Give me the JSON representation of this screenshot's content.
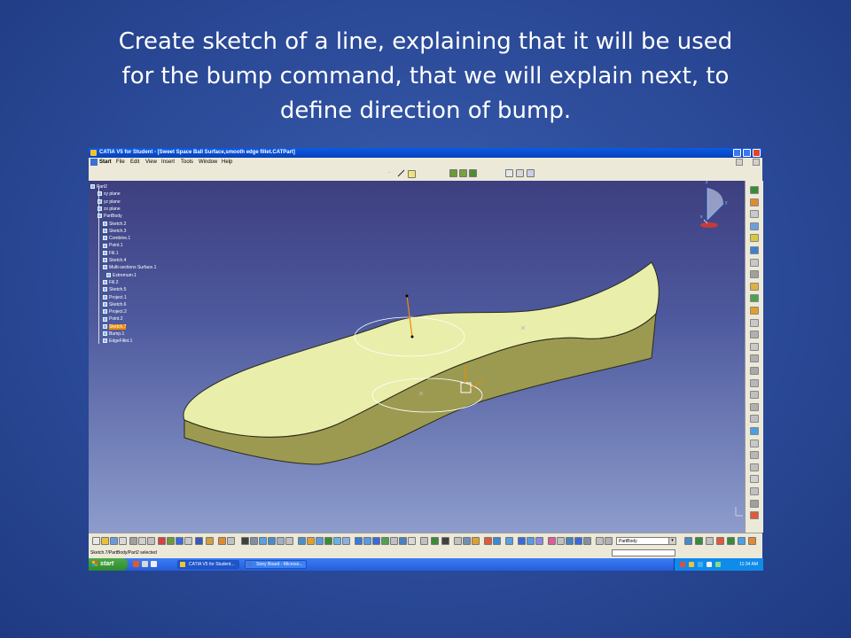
{
  "slide": {
    "title_lines": [
      "Create sketch of a line, explaining that it will be used",
      "for the bump command, that we will explain next, to",
      "define direction of bump."
    ]
  },
  "window": {
    "title": "CATIA V5 for Student - [Sweet Space Ball Surface,smooth edge fillet.CATPart]"
  },
  "menu": [
    "Start",
    "File",
    "Edit",
    "View",
    "Insert",
    "Tools",
    "Window",
    "Help"
  ],
  "tree": {
    "items": [
      {
        "label": "Part2",
        "icon": "part-icon"
      },
      {
        "label": "xy plane",
        "icon": "plane-icon"
      },
      {
        "label": "yz plane",
        "icon": "plane-icon"
      },
      {
        "label": "zx plane",
        "icon": "plane-icon"
      },
      {
        "label": "PartBody",
        "icon": "body-icon"
      },
      {
        "label": "Sketch.2",
        "icon": "sketch-icon"
      },
      {
        "label": "Sketch.3",
        "icon": "sketch-icon"
      },
      {
        "label": "Combine.1",
        "icon": "combine-icon"
      },
      {
        "label": "Point.1",
        "icon": "point-icon"
      },
      {
        "label": "Fill.1",
        "icon": "fill-icon"
      },
      {
        "label": "Sketch.4",
        "icon": "sketch-icon"
      },
      {
        "label": "Multi-sections Surface.1",
        "icon": "surface-icon"
      },
      {
        "label": "Extremum.1",
        "icon": "extremum-icon"
      },
      {
        "label": "Fill.2",
        "icon": "fill-icon"
      },
      {
        "label": "Sketch.5",
        "icon": "sketch-icon"
      },
      {
        "label": "Project.1",
        "icon": "project-icon"
      },
      {
        "label": "Sketch.6",
        "icon": "sketch-icon"
      },
      {
        "label": "Project.2",
        "icon": "project-icon"
      },
      {
        "label": "Point.2",
        "icon": "point-icon"
      },
      {
        "label": "Sketch.7",
        "icon": "sketch-icon",
        "selected": true
      },
      {
        "label": "Bump.1",
        "icon": "bump-icon"
      },
      {
        "label": "EdgeFillet.1",
        "icon": "fillet-icon"
      }
    ]
  },
  "compass": {
    "x": "x",
    "y": "y",
    "z": "z"
  },
  "workbench_combo": {
    "value": "PartBody"
  },
  "status": {
    "message": "Sketch.7/PartBody/Part2 selected"
  },
  "taskbar": {
    "start_label": "start",
    "tasks": [
      "CATIA V5 for Student...",
      "Story Board - Microso..."
    ],
    "clock": "11:34 AM"
  },
  "colors": {
    "slide_background": "#2b4a98",
    "surface_fill": "#e9eeaa",
    "surface_side": "#9c9a50",
    "selection": "#f08a00",
    "viewport_top": "#3d3f80",
    "viewport_bottom": "#8d9ccc"
  }
}
